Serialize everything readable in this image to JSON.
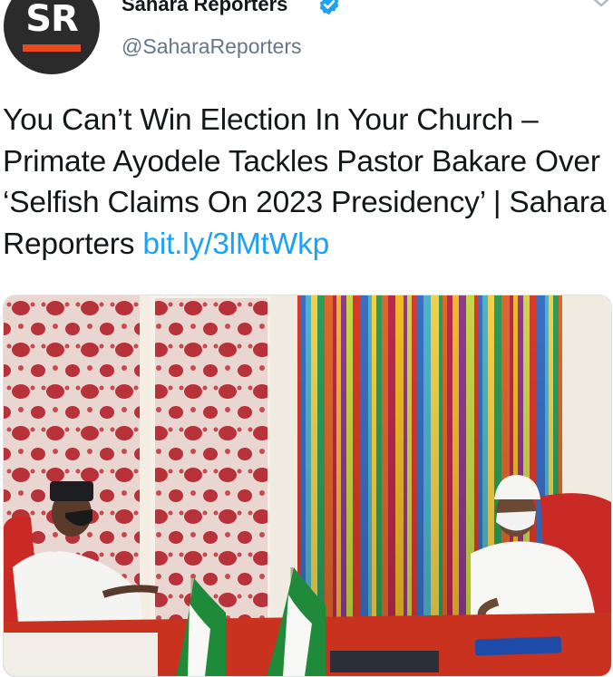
{
  "tweet": {
    "avatar": {
      "text": "SR",
      "bar_color": "#e8491d",
      "icon": "avatar"
    },
    "display_name": "Sahara Reporters",
    "verified_icon": "verified-badge-icon",
    "handle": "@SaharaReporters",
    "menu_icon": "chevron-down-icon",
    "text": "You Can’t Win Election In Your Church – Primate Ayodele Tackles Pastor Bakare Over ‘Selfish Claims On 2023 Presidency’ | Sahara Reporters ",
    "link": "bit.ly/3lMtWkp",
    "link_color": "#1da1f2",
    "media": {
      "type": "photo"
    }
  }
}
